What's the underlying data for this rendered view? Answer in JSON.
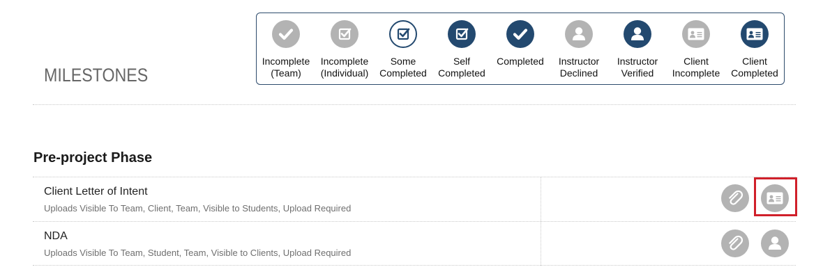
{
  "page": {
    "title": "MILESTONES"
  },
  "legend": {
    "items": [
      {
        "label": "Incomplete\n(Team)",
        "icon": "check-icon",
        "style": "gray"
      },
      {
        "label": "Incomplete\n(Individual)",
        "icon": "checkbox-icon",
        "style": "gray"
      },
      {
        "label": "Some\nCompleted",
        "icon": "checkbox-icon",
        "style": "outline-navy"
      },
      {
        "label": "Self\nCompleted",
        "icon": "checkbox-icon",
        "style": "navy"
      },
      {
        "label": "Completed",
        "icon": "check-icon",
        "style": "navy"
      },
      {
        "label": "Instructor\nDeclined",
        "icon": "user-icon",
        "style": "gray"
      },
      {
        "label": "Instructor\nVerified",
        "icon": "user-icon",
        "style": "navy"
      },
      {
        "label": "Client\nIncomplete",
        "icon": "id-card-icon",
        "style": "gray"
      },
      {
        "label": "Client\nCompleted",
        "icon": "id-card-icon",
        "style": "navy"
      }
    ]
  },
  "colors": {
    "navy": "#23496f",
    "gray": "#b3b3b3",
    "highlight": "#d0202a",
    "border": "#2c4a6b"
  },
  "phase": {
    "title": "Pre-project Phase",
    "milestones": [
      {
        "title": "Client Letter of Intent",
        "subtitle": "Uploads Visible To Team, Client, Team, Visible to Students, Upload Required",
        "actions": [
          "paperclip-icon",
          "id-card-icon"
        ]
      },
      {
        "title": "NDA",
        "subtitle": "Uploads Visible To Team, Student, Team, Visible to Clients, Upload Required",
        "actions": [
          "paperclip-icon",
          "user-icon"
        ]
      }
    ]
  }
}
